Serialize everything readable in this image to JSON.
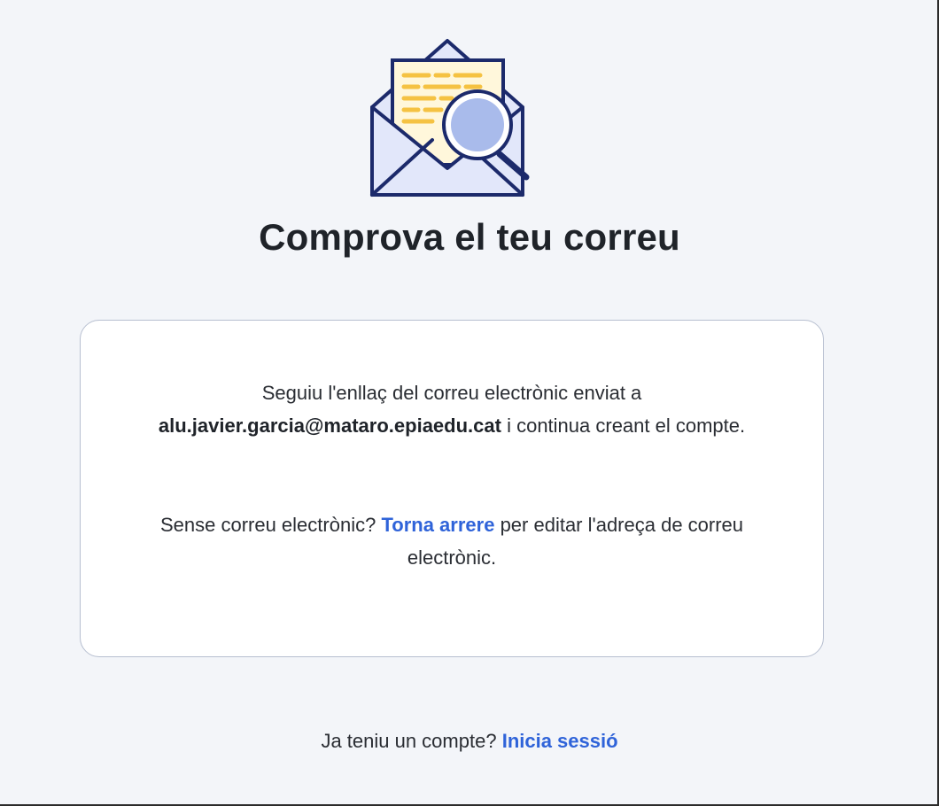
{
  "header": {
    "title": "Comprova el teu correu"
  },
  "illustration": {
    "icon": "envelope-magnifier-icon",
    "colors": {
      "outline": "#1c2a6b",
      "envelope": "#e2e7fa",
      "lens": "#a9bbeb",
      "lines": "#f5c242",
      "paper": "#fff7db"
    }
  },
  "card": {
    "paragraph1": {
      "text_before": "Seguiu l'enllaç del correu electrònic enviat a",
      "email": "alu.javier.garcia@mataro.epiaedu.cat",
      "text_after": "i continua creant el compte."
    },
    "paragraph2": {
      "text_before": "Sense correu electrònic?",
      "link_label": "Torna arrere",
      "text_after": "per editar l'adreça de correu electrònic."
    }
  },
  "footer": {
    "text": "Ja teniu un compte?",
    "link_label": "Inicia sessió"
  },
  "colors": {
    "background": "#f3f5f9",
    "link": "#2f63d9",
    "card_border": "#b7bfd0"
  }
}
